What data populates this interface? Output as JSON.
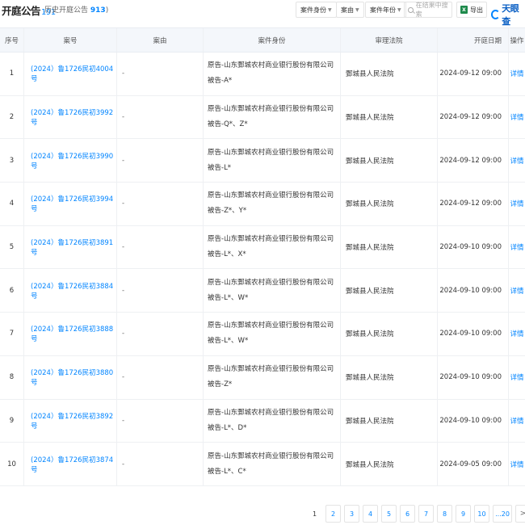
{
  "header": {
    "title": "开庭公告",
    "title_count": "191",
    "history_label": "历史开庭公告",
    "history_count": "913",
    "history_close": ")",
    "filters": [
      "案件身份",
      "案由",
      "案件年份"
    ],
    "search_placeholder": "在结果中搜索",
    "export_label": "导出",
    "logo_text": "天眼查"
  },
  "table": {
    "columns": [
      "序号",
      "案号",
      "案由",
      "案件身份",
      "审理法院",
      "开庭日期",
      "操作"
    ],
    "rows": [
      {
        "no": "1",
        "case": "(2024）鲁1726民初4004号",
        "cause": "-",
        "plaintiff": "原告-山东鄄城农村商业银行股份有限公司",
        "defendant": "被告-A*",
        "court": "鄄城县人民法院",
        "date": "2024-09-12 09:00",
        "action": "详情"
      },
      {
        "no": "2",
        "case": "(2024）鲁1726民初3992号",
        "cause": "-",
        "plaintiff": "原告-山东鄄城农村商业银行股份有限公司",
        "defendant": "被告-Q*、Z*",
        "court": "鄄城县人民法院",
        "date": "2024-09-12 09:00",
        "action": "详情"
      },
      {
        "no": "3",
        "case": "(2024）鲁1726民初3990号",
        "cause": "-",
        "plaintiff": "原告-山东鄄城农村商业银行股份有限公司",
        "defendant": "被告-L*",
        "court": "鄄城县人民法院",
        "date": "2024-09-12 09:00",
        "action": "详情"
      },
      {
        "no": "4",
        "case": "(2024）鲁1726民初3994号",
        "cause": "-",
        "plaintiff": "原告-山东鄄城农村商业银行股份有限公司",
        "defendant": "被告-Z*、Y*",
        "court": "鄄城县人民法院",
        "date": "2024-09-12 09:00",
        "action": "详情"
      },
      {
        "no": "5",
        "case": "(2024）鲁1726民初3891号",
        "cause": "-",
        "plaintiff": "原告-山东鄄城农村商业银行股份有限公司",
        "defendant": "被告-L*、X*",
        "court": "鄄城县人民法院",
        "date": "2024-09-10 09:00",
        "action": "详情"
      },
      {
        "no": "6",
        "case": "(2024）鲁1726民初3884号",
        "cause": "-",
        "plaintiff": "原告-山东鄄城农村商业银行股份有限公司",
        "defendant": "被告-L*、W*",
        "court": "鄄城县人民法院",
        "date": "2024-09-10 09:00",
        "action": "详情"
      },
      {
        "no": "7",
        "case": "(2024）鲁1726民初3888号",
        "cause": "-",
        "plaintiff": "原告-山东鄄城农村商业银行股份有限公司",
        "defendant": "被告-L*、W*",
        "court": "鄄城县人民法院",
        "date": "2024-09-10 09:00",
        "action": "详情"
      },
      {
        "no": "8",
        "case": "(2024）鲁1726民初3880号",
        "cause": "-",
        "plaintiff": "原告-山东鄄城农村商业银行股份有限公司",
        "defendant": "被告-Z*",
        "court": "鄄城县人民法院",
        "date": "2024-09-10 09:00",
        "action": "详情"
      },
      {
        "no": "9",
        "case": "(2024）鲁1726民初3892号",
        "cause": "-",
        "plaintiff": "原告-山东鄄城农村商业银行股份有限公司",
        "defendant": "被告-L*、D*",
        "court": "鄄城县人民法院",
        "date": "2024-09-10 09:00",
        "action": "详情"
      },
      {
        "no": "10",
        "case": "(2024）鲁1726民初3874号",
        "cause": "-",
        "plaintiff": "原告-山东鄄城农村商业银行股份有限公司",
        "defendant": "被告-L*、C*",
        "court": "鄄城县人民法院",
        "date": "2024-09-05 09:00",
        "action": "详情"
      }
    ]
  },
  "pagination": {
    "pages": [
      "1",
      "2",
      "3",
      "4",
      "5",
      "6",
      "7",
      "8",
      "9",
      "10",
      "...20"
    ],
    "current": "1",
    "next": ">"
  },
  "colors": {
    "accent": "#0084ff",
    "header_bg": "#f4f7fb",
    "excel_green": "#1e8a4b"
  }
}
